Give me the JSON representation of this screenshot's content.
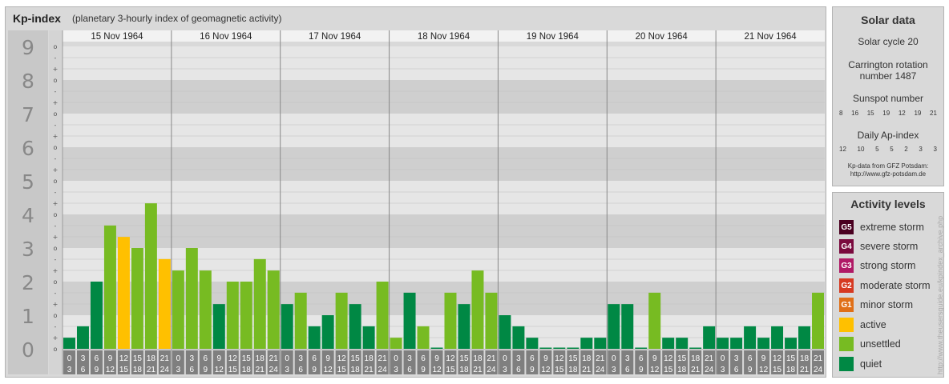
{
  "header": {
    "title": "Kp-index",
    "subtitle": "(planetary 3-hourly index of geomagnetic activity)"
  },
  "chart_data": {
    "type": "bar",
    "title": "Kp-index",
    "subtitle": "(planetary 3-hourly index of geomagnetic activity)",
    "days": [
      "15 Nov 1964",
      "16 Nov 1964",
      "17 Nov 1964",
      "18 Nov 1964",
      "19 Nov 1964",
      "20 Nov 1964",
      "21 Nov 1964"
    ],
    "y_ticks": [
      "0",
      "1",
      "2",
      "3",
      "4",
      "5",
      "6",
      "7",
      "8",
      "9"
    ],
    "minor_tick_labels": [
      "o",
      "+",
      "-"
    ],
    "time_bins": [
      [
        "0",
        "3"
      ],
      [
        "3",
        "6"
      ],
      [
        "6",
        "9"
      ],
      [
        "9",
        "12"
      ],
      [
        "12",
        "15"
      ],
      [
        "15",
        "18"
      ],
      [
        "18",
        "21"
      ],
      [
        "21",
        "24"
      ]
    ],
    "ylim": [
      0,
      9.33
    ],
    "values": [
      0.33,
      0.67,
      2.0,
      3.67,
      3.33,
      3.0,
      4.33,
      2.67,
      2.33,
      3.0,
      2.33,
      1.33,
      2.0,
      2.0,
      2.67,
      2.33,
      1.33,
      1.67,
      0.67,
      1.0,
      1.67,
      1.33,
      0.67,
      2.0,
      0.33,
      1.67,
      0.67,
      0.0,
      1.67,
      1.33,
      2.33,
      1.67,
      1.0,
      0.67,
      0.33,
      0.0,
      0.0,
      0.0,
      0.33,
      0.33,
      1.33,
      1.33,
      0.0,
      1.67,
      0.33,
      0.33,
      0.0,
      0.67,
      0.33,
      0.33,
      0.67,
      0.33,
      0.67,
      0.33,
      0.67,
      1.67
    ],
    "levels": [
      "quiet",
      "quiet",
      "quiet",
      "unsettled",
      "active",
      "unsettled",
      "unsettled",
      "active",
      "unsettled",
      "unsettled",
      "unsettled",
      "quiet",
      "unsettled",
      "unsettled",
      "unsettled",
      "unsettled",
      "quiet",
      "unsettled",
      "quiet",
      "quiet",
      "unsettled",
      "quiet",
      "quiet",
      "unsettled",
      "unsettled",
      "quiet",
      "unsettled",
      "quiet",
      "unsettled",
      "quiet",
      "unsettled",
      "unsettled",
      "quiet",
      "quiet",
      "quiet",
      "quiet",
      "quiet",
      "quiet",
      "quiet",
      "quiet",
      "quiet",
      "quiet",
      "quiet",
      "unsettled",
      "quiet",
      "quiet",
      "quiet",
      "quiet",
      "quiet",
      "quiet",
      "quiet",
      "quiet",
      "quiet",
      "quiet",
      "quiet",
      "unsettled"
    ],
    "level_colors": {
      "quiet": "#008844",
      "unsettled": "#77bb22",
      "active": "#ffc000"
    },
    "grid": true
  },
  "solar_data": {
    "title": "Solar data",
    "cycle": "Solar cycle 20",
    "carrington_line1": "Carrington rotation",
    "carrington_line2": "number 1487",
    "sunspot_label": "Sunspot number",
    "sunspot_values": [
      "8",
      "16",
      "15",
      "19",
      "12",
      "19",
      "21"
    ],
    "ap_label": "Daily Ap-index",
    "ap_values": [
      "12",
      "10",
      "5",
      "5",
      "2",
      "3",
      "3"
    ],
    "source_line1": "Kp-data from GFZ Potsdam:",
    "source_line2": "http://www.gfz-potsdam.de"
  },
  "activity_levels": {
    "title": "Activity levels",
    "items": [
      {
        "code": "G5",
        "label": "extreme storm",
        "color": "#4a0020"
      },
      {
        "code": "G4",
        "label": "severe storm",
        "color": "#7a0a3e"
      },
      {
        "code": "G3",
        "label": "strong storm",
        "color": "#b01a66"
      },
      {
        "code": "G2",
        "label": "moderate storm",
        "color": "#d63a22"
      },
      {
        "code": "G1",
        "label": "minor storm",
        "color": "#e07018"
      },
      {
        "code": "",
        "label": "active",
        "color": "#ffc000"
      },
      {
        "code": "",
        "label": "unsettled",
        "color": "#77bb22"
      },
      {
        "code": "",
        "label": "quiet",
        "color": "#008844"
      }
    ]
  },
  "credit": "http://www.theusersguide.eu/kpindex_archive.php"
}
